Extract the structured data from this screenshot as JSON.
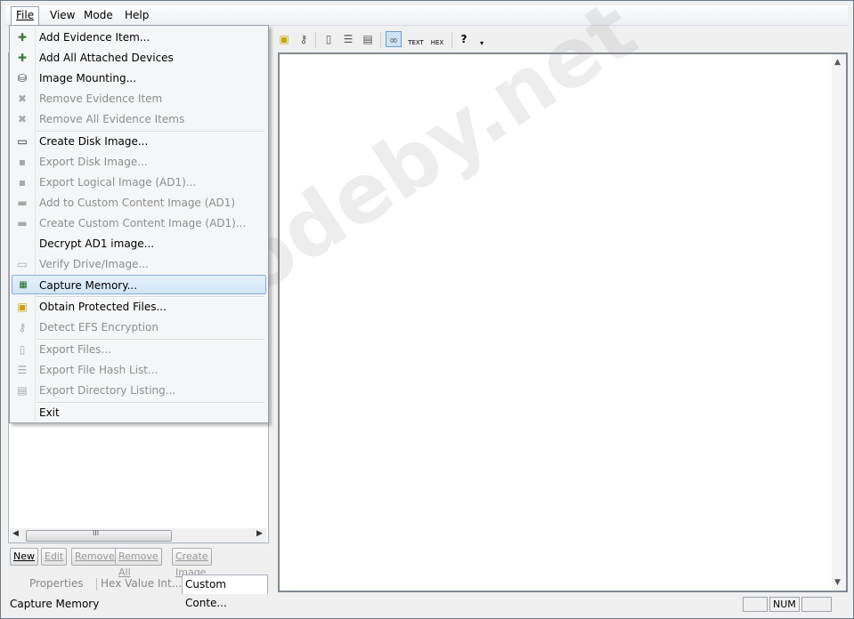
{
  "menubar": {
    "file": "File",
    "view": "View",
    "mode": "Mode",
    "help": "Help"
  },
  "file_menu": {
    "items": [
      {
        "label": "Add Evidence Item...",
        "enabled": true,
        "icon": "add-evidence-icon"
      },
      {
        "label": "Add All Attached Devices",
        "enabled": true,
        "icon": "attached-devices-icon"
      },
      {
        "label": "Image Mounting...",
        "enabled": true,
        "icon": "image-mounting-icon"
      },
      {
        "label": "Remove Evidence Item",
        "enabled": false,
        "icon": "remove-evidence-icon"
      },
      {
        "label": "Remove All Evidence Items",
        "enabled": false,
        "icon": "remove-all-evidence-icon"
      },
      {
        "label": "Create Disk Image...",
        "enabled": true,
        "icon": "disk-image-icon"
      },
      {
        "label": "Export Disk Image...",
        "enabled": false,
        "icon": "floppy-icon"
      },
      {
        "label": "Export Logical Image (AD1)...",
        "enabled": false,
        "icon": "logical-image-icon"
      },
      {
        "label": "Add to Custom Content Image (AD1)",
        "enabled": false,
        "icon": "custom-content-add-icon"
      },
      {
        "label": "Create Custom Content Image (AD1)...",
        "enabled": false,
        "icon": "custom-content-create-icon"
      },
      {
        "label": "Decrypt AD1 image...",
        "enabled": true,
        "icon": ""
      },
      {
        "label": "Verify Drive/Image...",
        "enabled": false,
        "icon": "verify-drive-icon"
      },
      {
        "label": "Capture Memory...",
        "enabled": true,
        "icon": "memory-chip-icon"
      },
      {
        "label": "Obtain Protected Files...",
        "enabled": true,
        "icon": "protected-files-icon"
      },
      {
        "label": "Detect EFS Encryption",
        "enabled": false,
        "icon": "key-icon"
      },
      {
        "label": "Export Files...",
        "enabled": false,
        "icon": "file-icon"
      },
      {
        "label": "Export File Hash List...",
        "enabled": false,
        "icon": "hash-list-icon"
      },
      {
        "label": "Export Directory Listing...",
        "enabled": false,
        "icon": "directory-listing-icon"
      },
      {
        "label": "Exit",
        "enabled": true,
        "icon": ""
      }
    ]
  },
  "toolbar": {
    "text_label": "TEXT",
    "hex_label": "HEX",
    "help_glyph": "?"
  },
  "left_buttons": {
    "new": "New",
    "edit": "Edit",
    "remove": "Remove",
    "remove_all": "Remove All",
    "create_image": "Create Image"
  },
  "left_tabs": {
    "properties": "Properties",
    "hex_value": "Hex Value Int...",
    "custom_content": "Custom Conte..."
  },
  "hscroll_grip": "III",
  "status": {
    "text": "Capture Memory",
    "num": "NUM"
  },
  "watermark": "codeby.net",
  "colors": {
    "highlight": "#d2e6f8",
    "highlight_border": "#86b0d9",
    "disabled_text": "#8d8d8d"
  }
}
